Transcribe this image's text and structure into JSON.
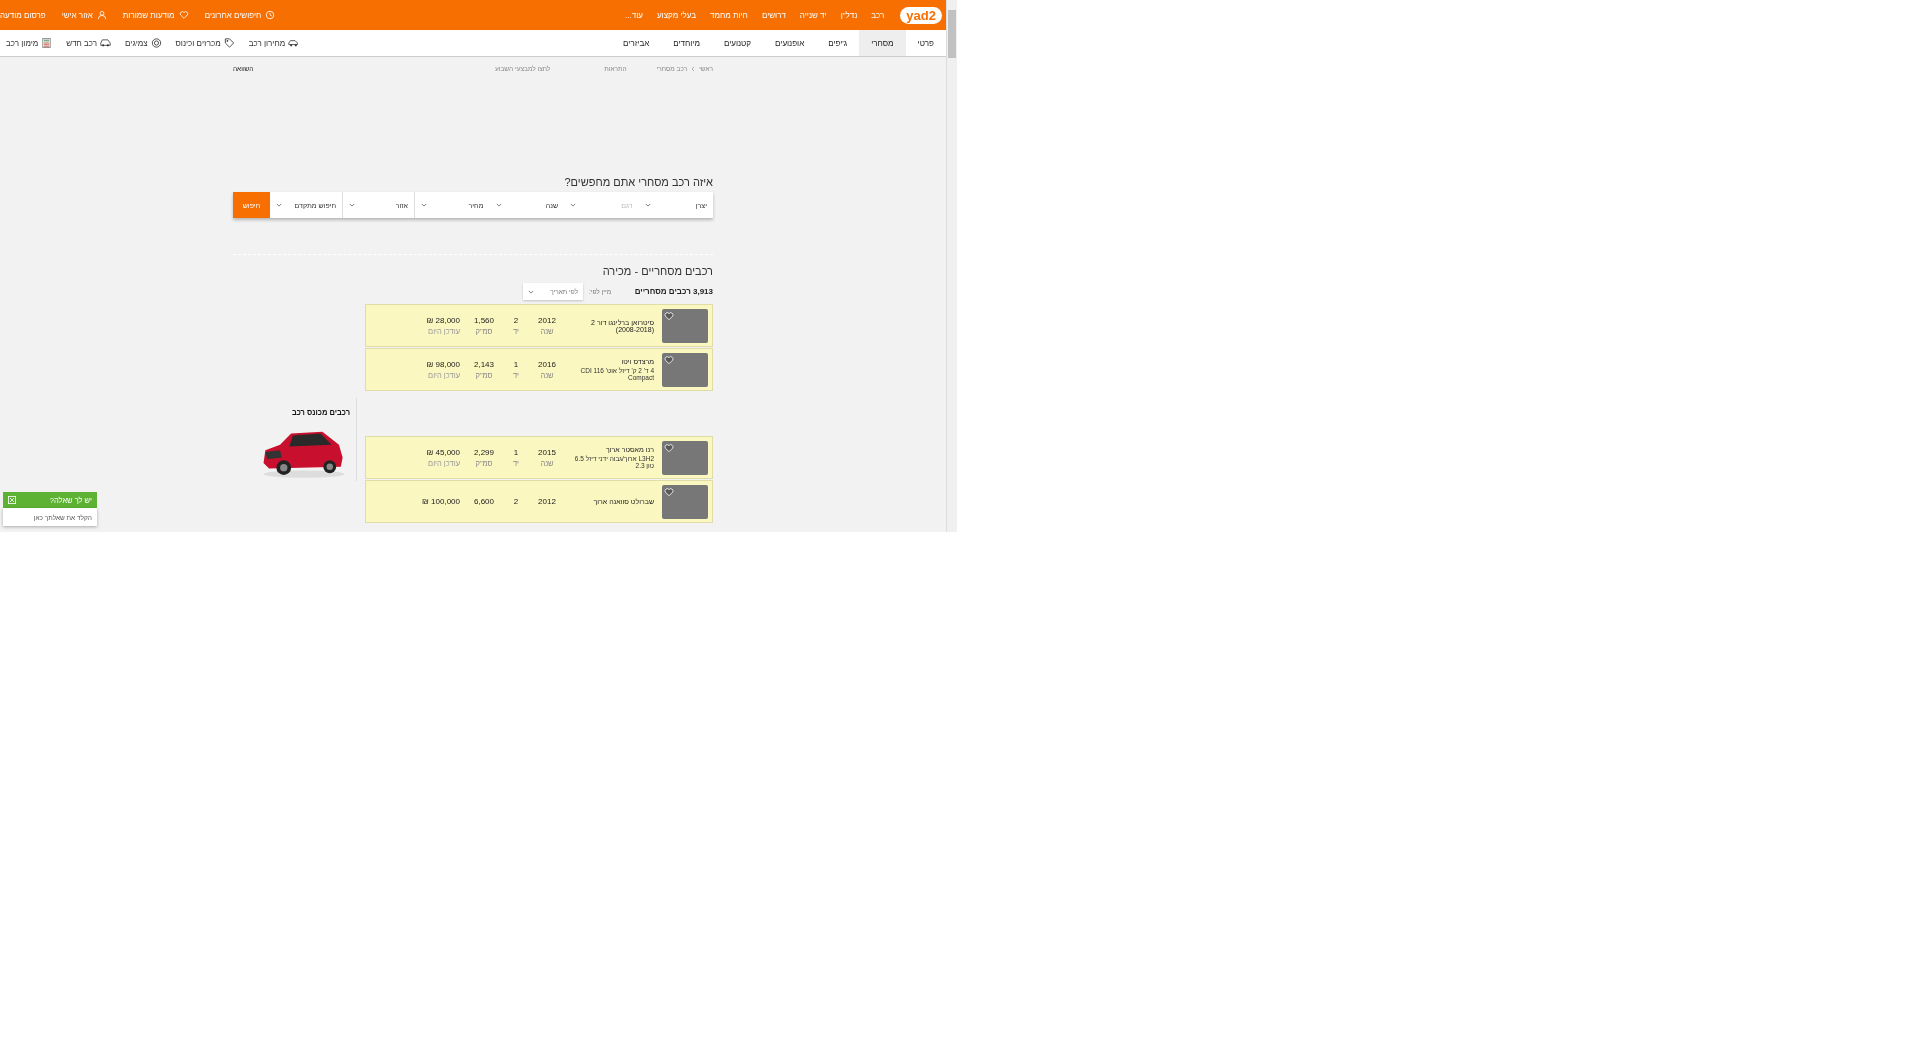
{
  "top_bar": {
    "logo": "yad2",
    "nav": [
      "רכב",
      "נדל\"ן",
      "יד שנייה",
      "דרושים",
      "חיות מחמד",
      "בעלי מקצוע",
      "עוד..."
    ],
    "actions": [
      {
        "kind": "history",
        "label": "חיפושים אחרונים"
      },
      {
        "kind": "heart",
        "label": "מודעות שמורות"
      },
      {
        "kind": "user",
        "label": "אזור אישי"
      },
      {
        "kind": "none",
        "label": "פרסום מודעה"
      }
    ]
  },
  "category_bar": {
    "tabs": [
      {
        "label": "פרטי",
        "selected": false
      },
      {
        "label": "מסחרי",
        "selected": true
      },
      {
        "label": "ג'יפים",
        "selected": false
      },
      {
        "label": "אופנועים",
        "selected": false
      },
      {
        "label": "קטנועים",
        "selected": false
      },
      {
        "label": "מיוחדים",
        "selected": false
      },
      {
        "label": "אביזרים",
        "selected": false
      }
    ],
    "links": [
      {
        "kind": "price",
        "label": "מחירון רכב"
      },
      {
        "kind": "tag",
        "label": "מכרזים וכינוס"
      },
      {
        "kind": "tire",
        "label": "צמיגים"
      },
      {
        "kind": "car",
        "label": "רכב חדש"
      },
      {
        "kind": "calc",
        "label": "מימון רכב"
      }
    ]
  },
  "breadcrumb": {
    "items": [
      "ראשי",
      "רכב מסחרי"
    ],
    "alerts": "התראות",
    "promo": "לחצו למבצעי השבוע",
    "compare": "השוואה"
  },
  "search": {
    "title": "איזה רכב מסחרי אתם מחפשים?",
    "filters": [
      {
        "label": "יצרן",
        "disabled": false
      },
      {
        "label": "דגם",
        "disabled": true
      },
      {
        "label": "שנה",
        "disabled": false
      },
      {
        "label": "מחיר",
        "disabled": false
      },
      {
        "label": "אזור",
        "disabled": false
      },
      {
        "label": "חיפוש מתקדם",
        "disabled": false
      }
    ],
    "button": "חיפוש"
  },
  "results": {
    "title": "רכבים מסחריים - מכירה",
    "count": "3,913 רכבים מסחריים",
    "sort_label": "מיין לפי:",
    "sort_value": "לפי תאריך",
    "listings": [
      {
        "title": "סיטרואן ברלינגו דור 2 (2008-2018)",
        "specs": [
          {
            "value": "2012",
            "label": "שנה"
          },
          {
            "value": "2",
            "label": "יד"
          },
          {
            "value": "1,560",
            "label": "סמ\"ק"
          }
        ],
        "price": "28,000 ₪",
        "note": "עודכן היום"
      },
      {
        "title": "מרצדס ויטו",
        "subtitle": "4 ד' 2 ק' דיזל אוט' CDI 116 Compact",
        "specs": [
          {
            "value": "2016",
            "label": "שנה"
          },
          {
            "value": "1",
            "label": "יד"
          },
          {
            "value": "2,143",
            "label": "סמ\"ק"
          }
        ],
        "price": "98,000 ₪",
        "note": "עודכן היום"
      },
      {
        "title": "רנו מאסטר ארוך",
        "subtitle": "L3H2 ארוך/גבוה ידני דיזל 6.5 טון 2.3",
        "specs": [
          {
            "value": "2015",
            "label": "שנה"
          },
          {
            "value": "1",
            "label": "יד"
          },
          {
            "value": "2,299",
            "label": "סמ\"ק"
          }
        ],
        "price": "45,000 ₪",
        "note": "עודכן היום"
      },
      {
        "title": "שברולט סוואנה ארוך",
        "specs": [
          {
            "value": "2012"
          },
          {
            "value": "2"
          },
          {
            "value": "6,600"
          }
        ],
        "price": "100,000 ₪"
      }
    ]
  },
  "side_panel": {
    "title": "רכבים מכונס רכב"
  },
  "chat": {
    "title": "יש לך שאלה?",
    "placeholder": "הקלד את שאלתך כאן"
  }
}
